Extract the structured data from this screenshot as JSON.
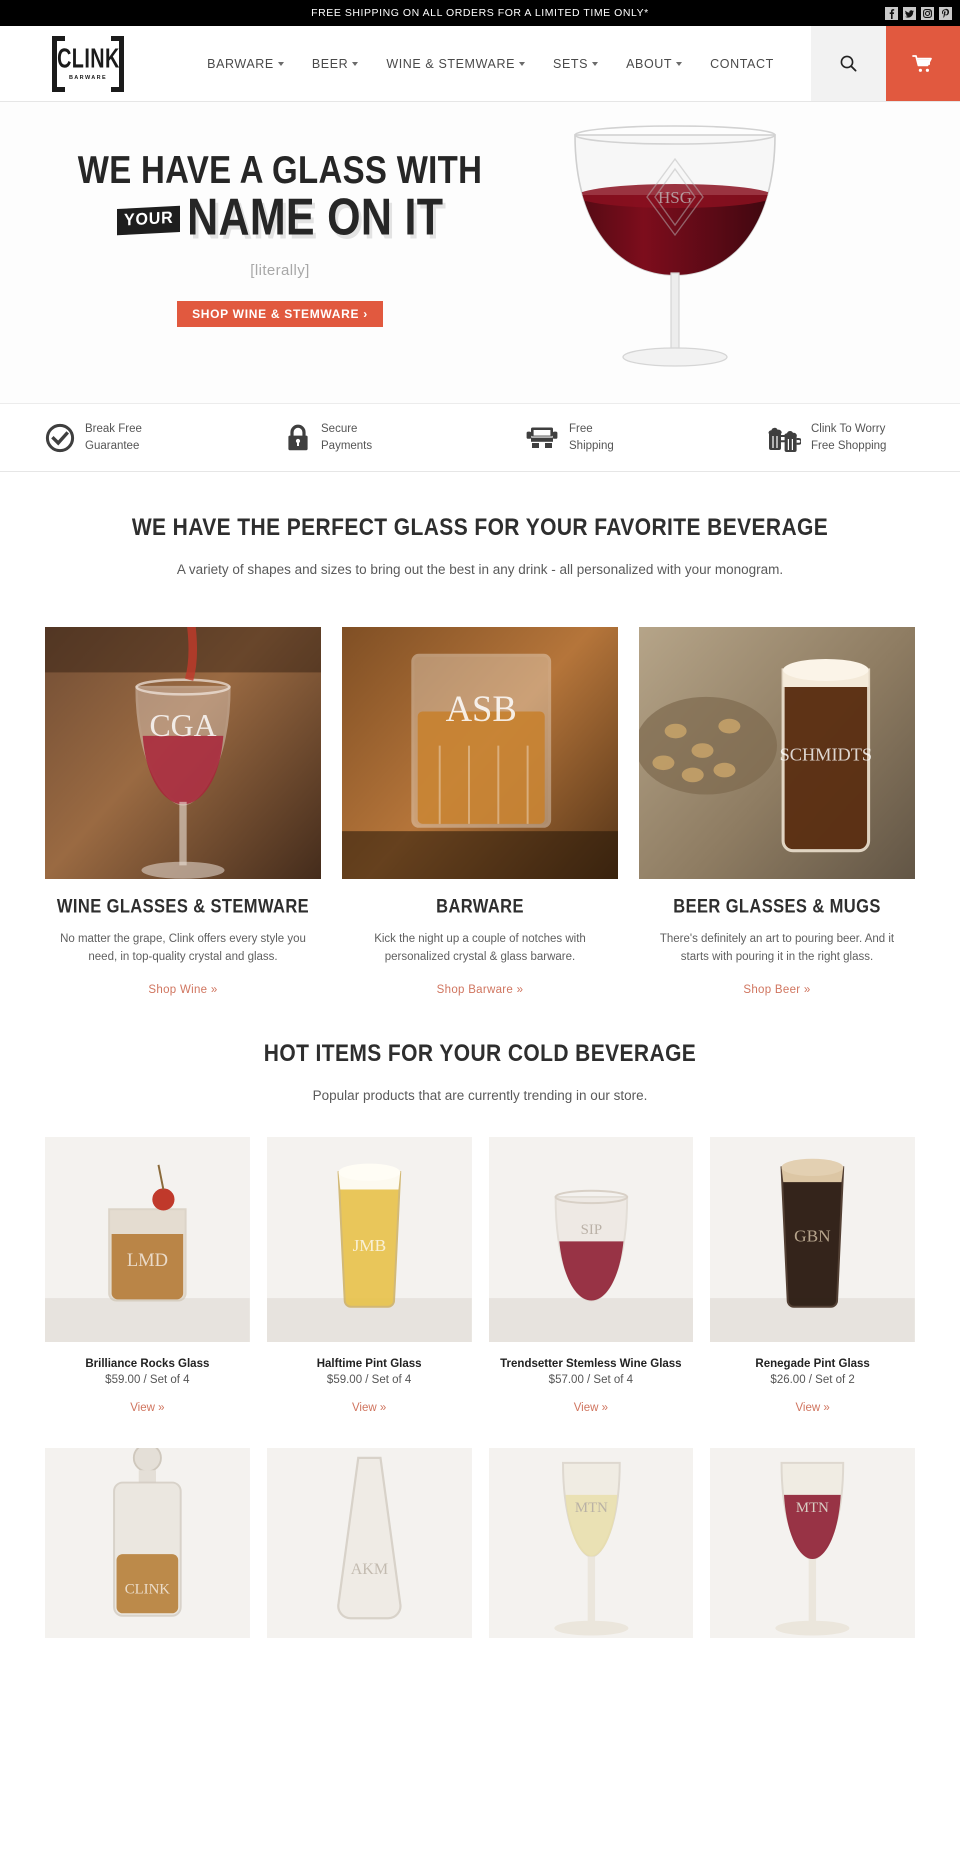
{
  "announcement": {
    "text": "FREE SHIPPING ON ALL ORDERS FOR A LIMITED TIME ONLY*",
    "social": [
      {
        "name": "facebook-icon",
        "glyph": "f"
      },
      {
        "name": "twitter-icon",
        "glyph": "t"
      },
      {
        "name": "instagram-icon",
        "glyph": "o"
      },
      {
        "name": "pinterest-icon",
        "glyph": "P"
      }
    ]
  },
  "brand": {
    "name": "CLINK",
    "tagline": "BARWARE"
  },
  "nav": {
    "items": [
      {
        "label": "BARWARE",
        "has_dropdown": true
      },
      {
        "label": "BEER",
        "has_dropdown": true
      },
      {
        "label": "WINE & STEMWARE",
        "has_dropdown": true
      },
      {
        "label": "SETS",
        "has_dropdown": true
      },
      {
        "label": "ABOUT",
        "has_dropdown": true
      },
      {
        "label": "CONTACT",
        "has_dropdown": false
      }
    ],
    "search_label": "search-icon",
    "cart_label": "cart-icon"
  },
  "hero": {
    "line1": "WE HAVE A GLASS WITH",
    "emphasis": "YOUR",
    "line2": "NAME ON IT",
    "subtitle": "[literally]",
    "cta": "SHOP WINE & STEMWARE ›",
    "monogram": "HSG"
  },
  "badges": [
    {
      "icon": "check-circle-icon",
      "line1": "Break Free",
      "line2": "Guarantee"
    },
    {
      "icon": "lock-icon",
      "line1": "Secure",
      "line2": "Payments"
    },
    {
      "icon": "truck-icon",
      "line1": "Free",
      "line2": "Shipping"
    },
    {
      "icon": "beer-mugs-icon",
      "line1": "Clink To Worry",
      "line2": "Free Shopping"
    }
  ],
  "categories_section": {
    "title": "WE HAVE THE PERFECT GLASS FOR YOUR FAVORITE BEVERAGE",
    "subtitle": "A variety of shapes and sizes to bring out the best in any drink - all personalized with your monogram.",
    "cards": [
      {
        "name": "WINE GLASSES & STEMWARE",
        "description": "No matter the grape, Clink offers every style you need, in top-quality crystal and glass.",
        "link": "Shop Wine »",
        "monogram": "CGA"
      },
      {
        "name": "BARWARE",
        "description": "Kick the night up a couple of notches with personalized crystal & glass barware.",
        "link": "Shop Barware »",
        "monogram": "ASB"
      },
      {
        "name": "BEER GLASSES & MUGS",
        "description": "There's definitely an art to pouring beer. And it starts with pouring it in the right glass.",
        "link": "Shop Beer »",
        "monogram": "SCHMIDTS"
      }
    ]
  },
  "products_section": {
    "title": "HOT ITEMS FOR YOUR COLD BEVERAGE",
    "subtitle": "Popular products that are currently trending in our store.",
    "view_label": "View »",
    "row1": [
      {
        "name": "Brilliance Rocks Glass",
        "price": "$59.00 / Set of 4",
        "link": "View »",
        "monogram": "LMD"
      },
      {
        "name": "Halftime Pint Glass",
        "price": "$59.00 / Set of 4",
        "link": "View »",
        "monogram": "JMB"
      },
      {
        "name": "Trendsetter Stemless Wine Glass",
        "price": "$57.00 / Set of 4",
        "link": "View »",
        "monogram": "SIP"
      },
      {
        "name": "Renegade Pint Glass",
        "price": "$26.00 / Set of 2",
        "link": "View »",
        "monogram": "GBN"
      }
    ],
    "row2": [
      {
        "monogram": "CLINK"
      },
      {
        "monogram": "AKM"
      },
      {
        "monogram": "MTN"
      },
      {
        "monogram": "MTN"
      }
    ]
  },
  "colors": {
    "accent": "#e1593f",
    "link": "#d0755f",
    "dark": "#1b1b1b",
    "text": "#555555"
  }
}
